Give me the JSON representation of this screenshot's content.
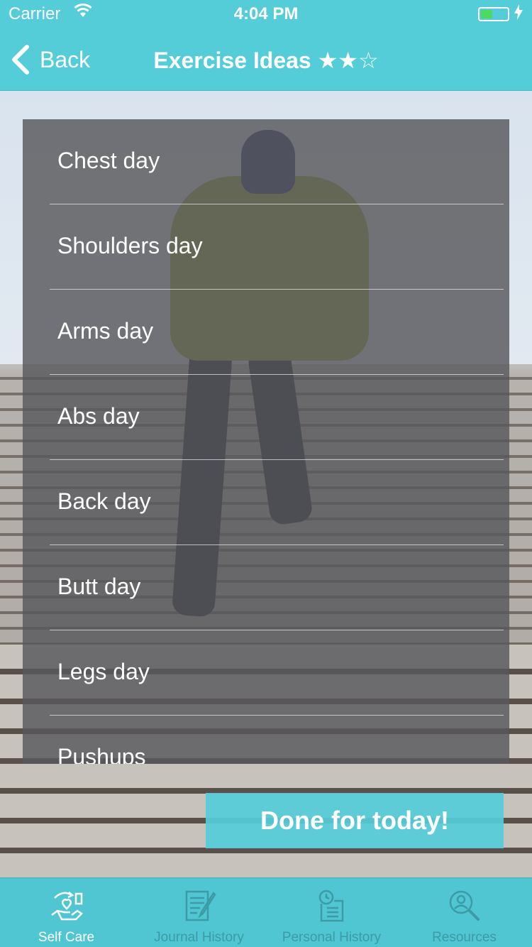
{
  "status_bar": {
    "carrier": "Carrier",
    "time": "4:04 PM"
  },
  "nav": {
    "back_label": "Back",
    "title": "Exercise Ideas ★★☆"
  },
  "list": {
    "items": [
      {
        "label": "Chest day"
      },
      {
        "label": "Shoulders day"
      },
      {
        "label": "Arms day"
      },
      {
        "label": "Abs day"
      },
      {
        "label": "Back day"
      },
      {
        "label": "Butt day"
      },
      {
        "label": "Legs day"
      },
      {
        "label": "Pushups"
      }
    ]
  },
  "done_button": {
    "label": "Done for today!"
  },
  "tabbar": {
    "tabs": [
      {
        "label": "Self Care",
        "icon": "self-care-icon",
        "active": true
      },
      {
        "label": "Journal History",
        "icon": "journal-icon",
        "active": false
      },
      {
        "label": "Personal History",
        "icon": "personal-history-icon",
        "active": false
      },
      {
        "label": "Resources",
        "icon": "resources-icon",
        "active": false
      }
    ]
  },
  "colors": {
    "accent": "#54cdd9",
    "tab_inactive": "#3c9ba5",
    "battery_fill": "#4cd964"
  }
}
